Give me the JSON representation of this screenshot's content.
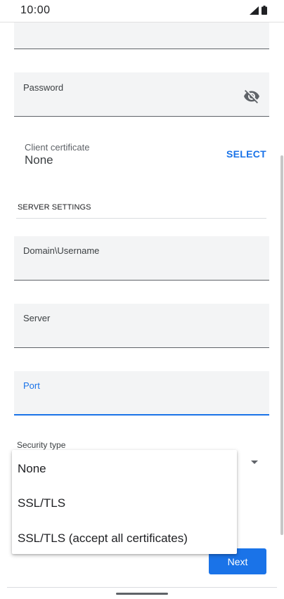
{
  "status_bar": {
    "time": "10:00",
    "icons": [
      "signal-icon",
      "battery-icon"
    ]
  },
  "form": {
    "password_label": "Password",
    "password_toggle_icon": "visibility-off-icon",
    "client_certificate_label": "Client certificate",
    "client_certificate_value": "None",
    "select_label": "SELECT",
    "server_settings_header": "SERVER SETTINGS",
    "domain_username_label": "Domain\\Username",
    "server_label": "Server",
    "port_label": "Port",
    "security_type_label": "Security type",
    "next_label": "Next"
  },
  "security_menu": {
    "options": [
      "None",
      "SSL/TLS",
      "SSL/TLS (accept all certificates)"
    ]
  },
  "colors": {
    "accent": "#1a73e8",
    "field_background": "#f3f4f5",
    "text": "#202124"
  }
}
